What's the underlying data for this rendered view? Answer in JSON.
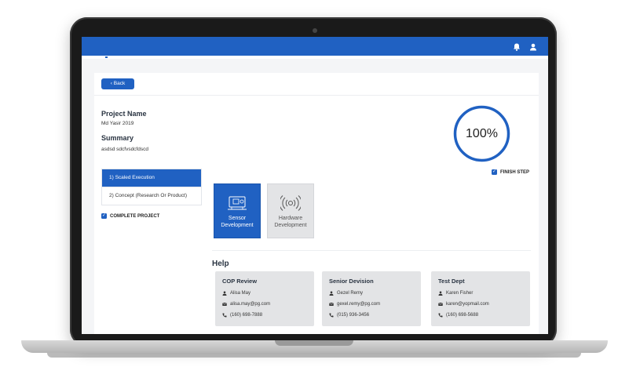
{
  "topbar": {
    "icons": [
      "bell-icon",
      "user-icon"
    ],
    "color": "#2061c2"
  },
  "back_button": {
    "label": "Back"
  },
  "project": {
    "name_label": "Project Name",
    "name_value": "Md Yasir 2019",
    "summary_label": "Summary",
    "summary_value": "asdsd sdcfvsdcfdscd"
  },
  "steps": [
    {
      "label": "1) Scaled Execution",
      "active": true
    },
    {
      "label": "2) Concept (Research Or Product)",
      "active": false
    }
  ],
  "complete_project": {
    "label": "COMPLETE PROJECT",
    "checked": true
  },
  "progress": {
    "label": "100%",
    "value": 1.0
  },
  "finish_step": {
    "label": "FINISH STEP",
    "checked": true
  },
  "tiles": [
    {
      "line1": "Sensor",
      "line2": "Development",
      "icon": "sensor-board-icon",
      "selected": true
    },
    {
      "line1": "Hardware",
      "line2": "Development",
      "icon": "wireless-signal-icon",
      "selected": false
    }
  ],
  "help": {
    "title": "Help",
    "cards": [
      {
        "title": "COP Review",
        "name": "Alisa May",
        "email": "alisa.may@pg.com",
        "phone": "(160) 698-7888"
      },
      {
        "title": "Senior Devision",
        "name": "Gezel Remy",
        "email": "gexel.remy@pg.com",
        "phone": "(015) 936-3456"
      },
      {
        "title": "Test Dept",
        "name": "Karen Fisher",
        "email": "karen@yopmail.com",
        "phone": "(160) 698-5688"
      }
    ]
  }
}
